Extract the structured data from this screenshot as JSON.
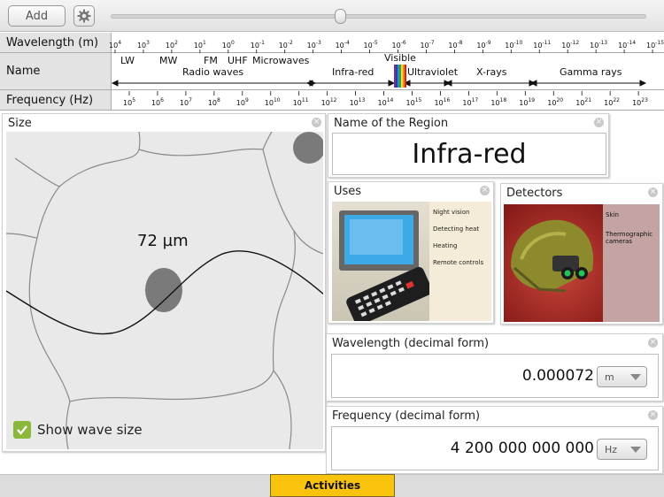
{
  "toolbar": {
    "add_label": "Add",
    "settings_icon": "gear-icon",
    "zoom_slider_position": 0.42
  },
  "scale": {
    "wavelength_label": "Wavelength (m)",
    "name_label": "Name",
    "frequency_label": "Frequency (Hz)",
    "wavelength_ticks": [
      {
        "base": "10",
        "exp": "4"
      },
      {
        "base": "10",
        "exp": "3"
      },
      {
        "base": "10",
        "exp": "2"
      },
      {
        "base": "10",
        "exp": "1"
      },
      {
        "base": "10",
        "exp": "0"
      },
      {
        "base": "10",
        "exp": "-1"
      },
      {
        "base": "10",
        "exp": "-2"
      },
      {
        "base": "10",
        "exp": "-3"
      },
      {
        "base": "10",
        "exp": "-4"
      },
      {
        "base": "10",
        "exp": "-5"
      },
      {
        "base": "10",
        "exp": "-6"
      },
      {
        "base": "10",
        "exp": "-7"
      },
      {
        "base": "10",
        "exp": "-8"
      },
      {
        "base": "10",
        "exp": "-9"
      },
      {
        "base": "10",
        "exp": "-10"
      },
      {
        "base": "10",
        "exp": "-11"
      },
      {
        "base": "10",
        "exp": "-12"
      },
      {
        "base": "10",
        "exp": "-13"
      },
      {
        "base": "10",
        "exp": "-14"
      },
      {
        "base": "10",
        "exp": "-15"
      }
    ],
    "frequency_ticks": [
      {
        "base": "10",
        "exp": "5"
      },
      {
        "base": "10",
        "exp": "6"
      },
      {
        "base": "10",
        "exp": "7"
      },
      {
        "base": "10",
        "exp": "8"
      },
      {
        "base": "10",
        "exp": "9"
      },
      {
        "base": "10",
        "exp": "10"
      },
      {
        "base": "10",
        "exp": "11"
      },
      {
        "base": "10",
        "exp": "12"
      },
      {
        "base": "10",
        "exp": "13"
      },
      {
        "base": "10",
        "exp": "14"
      },
      {
        "base": "10",
        "exp": "15"
      },
      {
        "base": "10",
        "exp": "16"
      },
      {
        "base": "10",
        "exp": "17"
      },
      {
        "base": "10",
        "exp": "18"
      },
      {
        "base": "10",
        "exp": "19"
      },
      {
        "base": "10",
        "exp": "20"
      },
      {
        "base": "10",
        "exp": "21"
      },
      {
        "base": "10",
        "exp": "22"
      },
      {
        "base": "10",
        "exp": "23"
      }
    ],
    "sub_bands": [
      "LW",
      "MW",
      "FM",
      "UHF",
      "Microwaves"
    ],
    "regions": [
      "Radio waves",
      "Infra-red",
      "Visible",
      "Ultraviolet",
      "X-rays",
      "Gamma rays"
    ],
    "visible_colors": [
      "#7b2d8e",
      "#2b3fa8",
      "#1f8fd6",
      "#3aa03c",
      "#f0e020",
      "#f08a1a",
      "#d82020"
    ]
  },
  "size_panel": {
    "title": "Size",
    "readout": "72 µm",
    "show_wave_label": "Show wave size",
    "show_wave_checked": true
  },
  "name_panel": {
    "title": "Name of the Region",
    "value": "Infra-red"
  },
  "uses_panel": {
    "title": "Uses",
    "items": [
      "Night vision",
      "Detecting heat",
      "Heating",
      "Remote controls"
    ]
  },
  "detectors_panel": {
    "title": "Detectors",
    "items": [
      "Skin",
      "Thermographic cameras"
    ]
  },
  "wavelength_panel": {
    "title": "Wavelength (decimal form)",
    "value": "0.000072",
    "unit": "m"
  },
  "frequency_panel": {
    "title": "Frequency (decimal form)",
    "value": "4 200 000 000 000",
    "unit": "Hz"
  },
  "bottom": {
    "activities_label": "Activities"
  },
  "colors": {
    "activities_tab": "#f8c20d",
    "checkbox": "#8ab83a",
    "band_label_bg": "#e3e3e3"
  }
}
